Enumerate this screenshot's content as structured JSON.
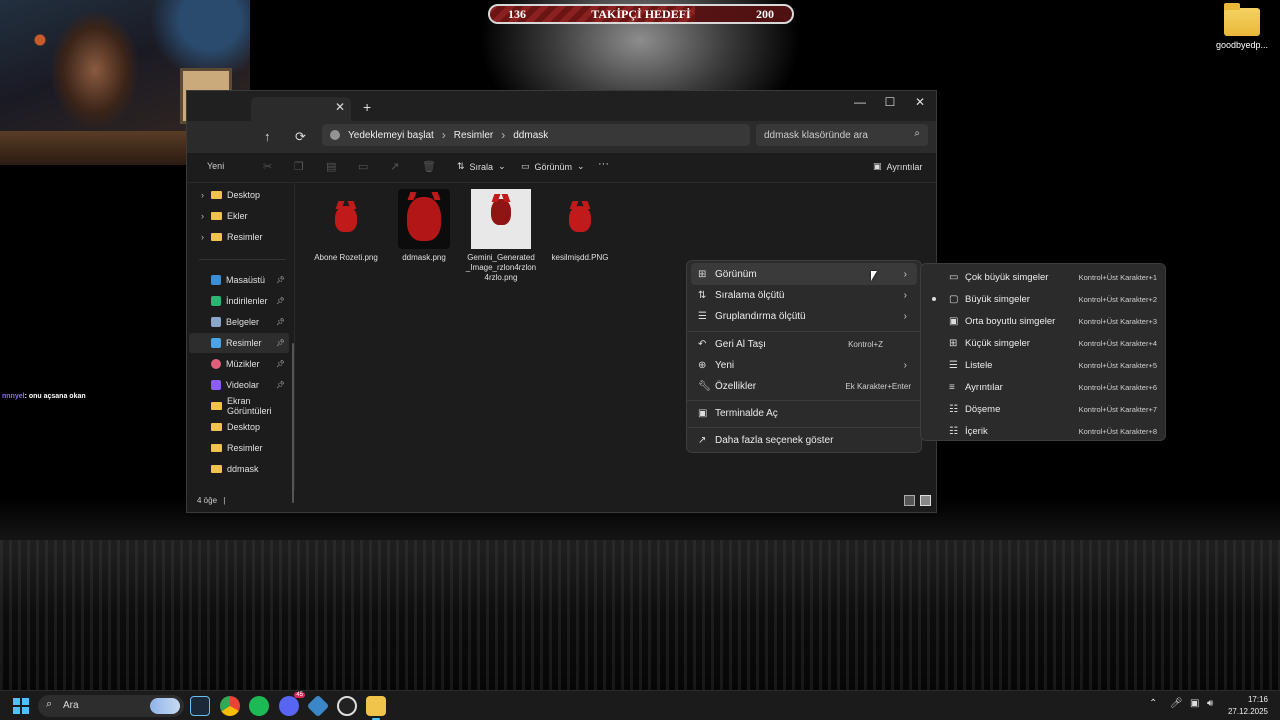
{
  "overlay": {
    "follower_goal": {
      "current": "136",
      "label": "TAKİPÇİ HEDEFİ",
      "target": "200",
      "progress": 0.68
    },
    "chat": {
      "user": "nnnyel",
      "message": ": onu açsana okan"
    }
  },
  "desktop": {
    "icons": [
      {
        "label": "goodbyedp..."
      }
    ]
  },
  "explorer": {
    "tab_close": "✕",
    "tab_add": "+",
    "window_controls": {
      "minimize": "—",
      "maximize": "☐",
      "close": "✕"
    },
    "nav": {
      "up": "↑",
      "refresh": "⟳"
    },
    "breadcrumb": [
      "Yedeklemeyi başlat",
      "Resimler",
      "ddmask"
    ],
    "breadcrumb_sep": "›",
    "search_placeholder": "ddmask klasöründe ara",
    "toolbar": {
      "new_label": "Yeni",
      "sort_label": "Sırala",
      "view_label": "Görünüm",
      "more_label": "···",
      "details_label": "Ayrıntılar"
    },
    "sidebar": {
      "tree": [
        "Desktop",
        "Ekler",
        "Resimler"
      ],
      "quick_access": [
        {
          "label": "Masaüstü",
          "icon": "desktop-icon"
        },
        {
          "label": "İndirilenler",
          "icon": "download-icon"
        },
        {
          "label": "Belgeler",
          "icon": "documents-icon"
        },
        {
          "label": "Resimler",
          "icon": "pictures-icon",
          "active": true
        },
        {
          "label": "Müzikler",
          "icon": "music-icon"
        },
        {
          "label": "Videolar",
          "icon": "videos-icon"
        }
      ],
      "folders": [
        "Ekran Görüntüleri",
        "Desktop",
        "Resimler",
        "ddmask"
      ]
    },
    "files": [
      {
        "name": "Abone Rozeti.png"
      },
      {
        "name": "ddmask.png"
      },
      {
        "name": "Gemini_Generated_Image_rzlon4rzlon4rzlo.png"
      },
      {
        "name": "kesilmişdd.PNG"
      }
    ],
    "status": {
      "count": "4 öğe",
      "sep": "|"
    }
  },
  "context_menu": {
    "items": [
      {
        "label": "Görünüm",
        "icon": "grid-icon",
        "shortcut": "",
        "submenu": true
      },
      {
        "label": "Sıralama ölçütü",
        "icon": "sort-icon",
        "shortcut": "",
        "submenu": true
      },
      {
        "label": "Gruplandırma ölçütü",
        "icon": "group-icon",
        "shortcut": "",
        "submenu": true
      },
      {
        "label": "Geri Al Taşı",
        "icon": "undo-icon",
        "shortcut": "Kontrol+Z",
        "submenu": false
      },
      {
        "label": "Yeni",
        "icon": "new-icon",
        "shortcut": "",
        "submenu": true
      },
      {
        "label": "Özellikler",
        "icon": "wrench-icon",
        "shortcut": "Ek Karakter+Enter",
        "submenu": false
      },
      {
        "label": "Terminalde Aç",
        "icon": "terminal-icon",
        "shortcut": "",
        "submenu": false
      },
      {
        "label": "Daha fazla seçenek göster",
        "icon": "more-options-icon",
        "shortcut": "",
        "submenu": false
      }
    ]
  },
  "view_submenu": {
    "items": [
      {
        "label": "Çok büyük simgeler",
        "shortcut": "Kontrol+Üst Karakter+1",
        "selected": false
      },
      {
        "label": "Büyük simgeler",
        "shortcut": "Kontrol+Üst Karakter+2",
        "selected": true
      },
      {
        "label": "Orta boyutlu simgeler",
        "shortcut": "Kontrol+Üst Karakter+3",
        "selected": false
      },
      {
        "label": "Küçük simgeler",
        "shortcut": "Kontrol+Üst Karakter+4",
        "selected": false
      },
      {
        "label": "Listele",
        "shortcut": "Kontrol+Üst Karakter+5",
        "selected": false
      },
      {
        "label": "Ayrıntılar",
        "shortcut": "Kontrol+Üst Karakter+6",
        "selected": false
      },
      {
        "label": "Döşeme",
        "shortcut": "Kontrol+Üst Karakter+7",
        "selected": false
      },
      {
        "label": "İçerik",
        "shortcut": "Kontrol+Üst Karakter+8",
        "selected": false
      }
    ]
  },
  "taskbar": {
    "search_label": "Ara",
    "apps": [
      "steam-icon",
      "chrome-icon",
      "spotify-icon",
      "discord-icon",
      "app-icon",
      "obs-icon",
      "file-explorer-icon"
    ],
    "discord_badge": "45",
    "time": "17:16",
    "date": "27.12.2025"
  },
  "colors": {
    "accent": "#4cc2ff",
    "folder": "#f0c44a",
    "mask_red": "#c11a1a",
    "goal_bar": "#6e1a1a"
  }
}
